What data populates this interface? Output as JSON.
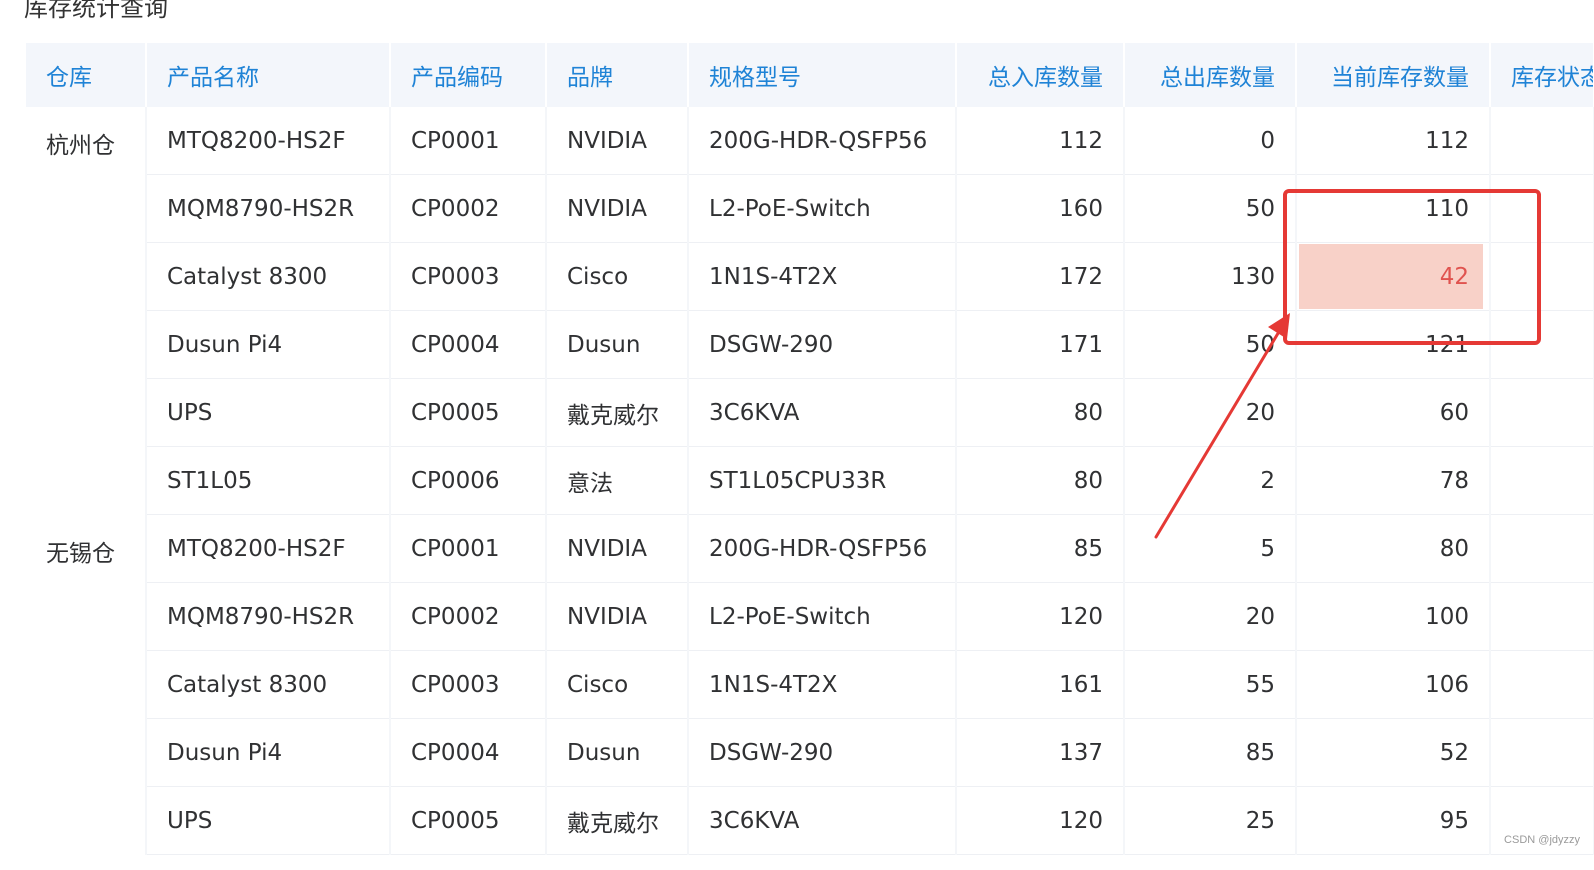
{
  "page": {
    "title": "库存统计查询"
  },
  "table": {
    "headers": [
      "仓库",
      "产品名称",
      "产品编码",
      "品牌",
      "规格型号",
      "总入库数量",
      "总出库数量",
      "当前库存数量",
      "库存状态"
    ],
    "groups": [
      {
        "warehouse": "杭州仓",
        "rows": [
          {
            "name": "MTQ8200-HS2F",
            "code": "CP0001",
            "brand": "NVIDIA",
            "spec": "200G-HDR-QSFP56",
            "in": "112",
            "out": "0",
            "stock": "112"
          },
          {
            "name": "MQM8790-HS2R",
            "code": "CP0002",
            "brand": "NVIDIA",
            "spec": "L2-PoE-Switch",
            "in": "160",
            "out": "50",
            "stock": "110"
          },
          {
            "name": "Catalyst 8300",
            "code": "CP0003",
            "brand": "Cisco",
            "spec": "1N1S-4T2X",
            "in": "172",
            "out": "130",
            "stock": "42",
            "alert": true
          },
          {
            "name": "Dusun Pi4",
            "code": "CP0004",
            "brand": "Dusun",
            "spec": "DSGW-290",
            "in": "171",
            "out": "50",
            "stock": "121"
          },
          {
            "name": "UPS",
            "code": "CP0005",
            "brand": "戴克威尔",
            "spec": "3C6KVA",
            "in": "80",
            "out": "20",
            "stock": "60"
          },
          {
            "name": "ST1L05",
            "code": "CP0006",
            "brand": "意法",
            "spec": "ST1L05CPU33R",
            "in": "80",
            "out": "2",
            "stock": "78"
          }
        ]
      },
      {
        "warehouse": "无锡仓",
        "rows": [
          {
            "name": "MTQ8200-HS2F",
            "code": "CP0001",
            "brand": "NVIDIA",
            "spec": "200G-HDR-QSFP56",
            "in": "85",
            "out": "5",
            "stock": "80"
          },
          {
            "name": "MQM8790-HS2R",
            "code": "CP0002",
            "brand": "NVIDIA",
            "spec": "L2-PoE-Switch",
            "in": "120",
            "out": "20",
            "stock": "100"
          },
          {
            "name": "Catalyst 8300",
            "code": "CP0003",
            "brand": "Cisco",
            "spec": "1N1S-4T2X",
            "in": "161",
            "out": "55",
            "stock": "106"
          },
          {
            "name": "Dusun Pi4",
            "code": "CP0004",
            "brand": "Dusun",
            "spec": "DSGW-290",
            "in": "137",
            "out": "85",
            "stock": "52"
          },
          {
            "name": "UPS",
            "code": "CP0005",
            "brand": "戴克威尔",
            "spec": "3C6KVA",
            "in": "120",
            "out": "25",
            "stock": "95"
          }
        ]
      }
    ]
  },
  "colors": {
    "header_text": "#1f83d6",
    "header_bg": "#f3f6fb",
    "alert_bg": "#f8d1c8",
    "alert_text": "#e0534f",
    "annotation": "#e53935"
  },
  "watermark": "CSDN @jdyzzy"
}
